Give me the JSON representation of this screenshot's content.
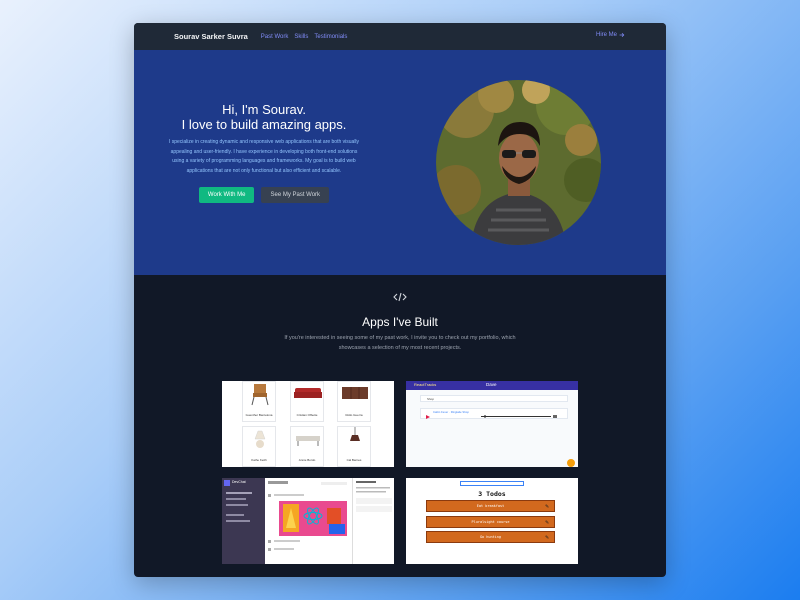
{
  "nav": {
    "brand": "Sourav Sarker Suvra",
    "links": [
      "Past Work",
      "Skills",
      "Testimonials"
    ],
    "hire": "Hire Me"
  },
  "hero": {
    "title_line1": "Hi, I'm Sourav.",
    "title_line2": "I love to build amazing apps.",
    "description": "I specialize in creating dynamic and responsive web applications that are both visually appealing and user-friendly. I have experience in developing both front-end solutions using a variety of programming languages and frameworks. My goal is to build web applications that are not only functional but also efficient and scalable.",
    "primary_button": "Work With Me",
    "secondary_button": "See My Past Work"
  },
  "apps": {
    "icon": "code-icon",
    "title": "Apps I've Built",
    "description": "If you're interested in seeing some of my past work, I invite you to check out my portfolio, which showcases a selection of my most recent projects."
  },
  "projects": {
    "furniture": {
      "items": [
        {
          "name": "Guenther Barcelona"
        },
        {
          "name": "Cristian Ofbette"
        },
        {
          "name": "Rollo Guerra"
        },
        {
          "name": "Kathe Keith"
        },
        {
          "name": "Annie Bordo"
        },
        {
          "name": "Cal Barnes"
        }
      ]
    },
    "music": {
      "app_name": "ReactTracks",
      "user": "Dave",
      "search": "Shop",
      "track": "Cabin Fever · Ringtaile Shop"
    },
    "chat": {
      "brand": "DevChat"
    },
    "todos": {
      "title": "3 Todos",
      "items": [
        "Eat breakfast",
        "Pluralsight course",
        "Go hunting"
      ]
    }
  },
  "colors": {
    "nav_bg": "#1f2937",
    "hero_bg": "#1e3a8a",
    "section_bg": "#111827",
    "accent_link": "#818cf8",
    "primary_button": "#10b981",
    "secondary_button": "#374151",
    "todo_bg": "#d2691e"
  }
}
